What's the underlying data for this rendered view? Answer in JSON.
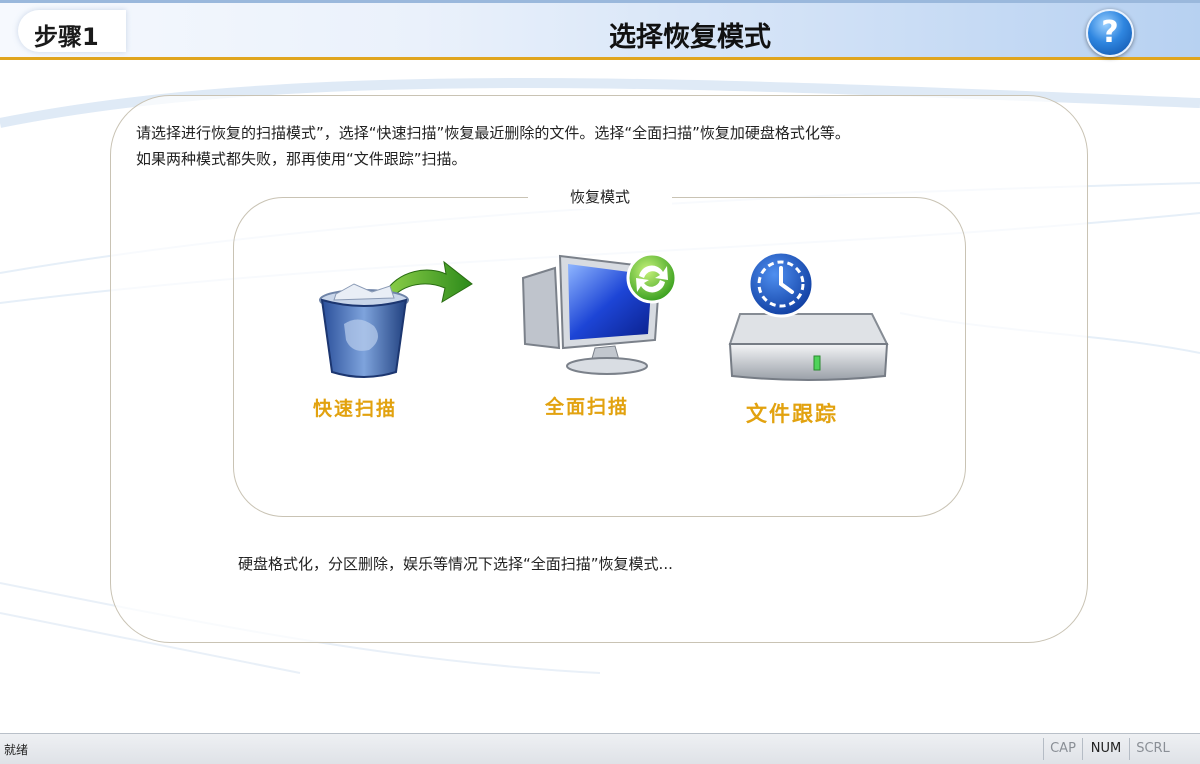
{
  "header": {
    "step_label": "步骤1",
    "title": "选择恢复模式",
    "help_symbol": "?"
  },
  "instructions": {
    "line1": "请选择进行恢复的扫描模式”，选择“快速扫描”恢复最近删除的文件。选择“全面扫描”恢复加硬盘格式化等。",
    "line2": "如果两种模式都失败，那再使用“文件跟踪”扫描。"
  },
  "modes": {
    "legend": "恢复模式",
    "items": [
      {
        "label": "快速扫描",
        "icon": "recycle-bin-arrow-icon"
      },
      {
        "label": "全面扫描",
        "icon": "monitor-refresh-icon"
      },
      {
        "label": "文件跟踪",
        "icon": "hard-drive-clock-icon"
      }
    ]
  },
  "hint": "硬盘格式化，分区删除，娱乐等情况下选择“全面扫描”恢复模式...",
  "status_bar": {
    "text": "就绪",
    "indicators": [
      "CAP",
      "NUM",
      "SCRL"
    ]
  },
  "colors": {
    "accent": "#e0a51e",
    "mode_label": "#e2a20f"
  }
}
